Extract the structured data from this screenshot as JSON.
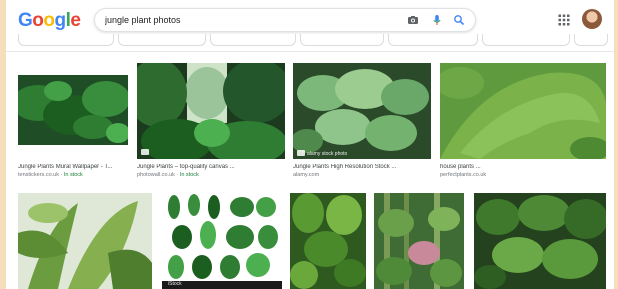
{
  "search": {
    "query": "jungle plant photos",
    "logo": [
      "G",
      "o",
      "o",
      "g",
      "l",
      "e"
    ]
  },
  "header": {
    "icons": [
      "camera-icon",
      "mic-icon",
      "search-icon",
      "apps-icon",
      "avatar"
    ]
  },
  "results": [
    {
      "title": "Jungle Plants Mural Wallpaper - T...",
      "source": "tenstickers.co.uk",
      "stock": "In stock"
    },
    {
      "title": "Jungle Plants – top-quality canvas ...",
      "source": "photowall.co.uk",
      "stock": "In stock"
    },
    {
      "title": "Jungle Plants High Resolution Stock ...",
      "source": "alamy.com",
      "stock": ""
    },
    {
      "title": "house plants ...",
      "source": "perfectplants.co.uk",
      "stock": ""
    }
  ],
  "watermarks": {
    "alamy": "alamy stock photo",
    "istock": "iStock"
  },
  "colors": {
    "background": "#f6deba",
    "google_blue": "#4285f4",
    "google_red": "#ea4335",
    "google_yellow": "#fbbc05",
    "google_green": "#34a853",
    "in_stock_green": "#188038"
  }
}
